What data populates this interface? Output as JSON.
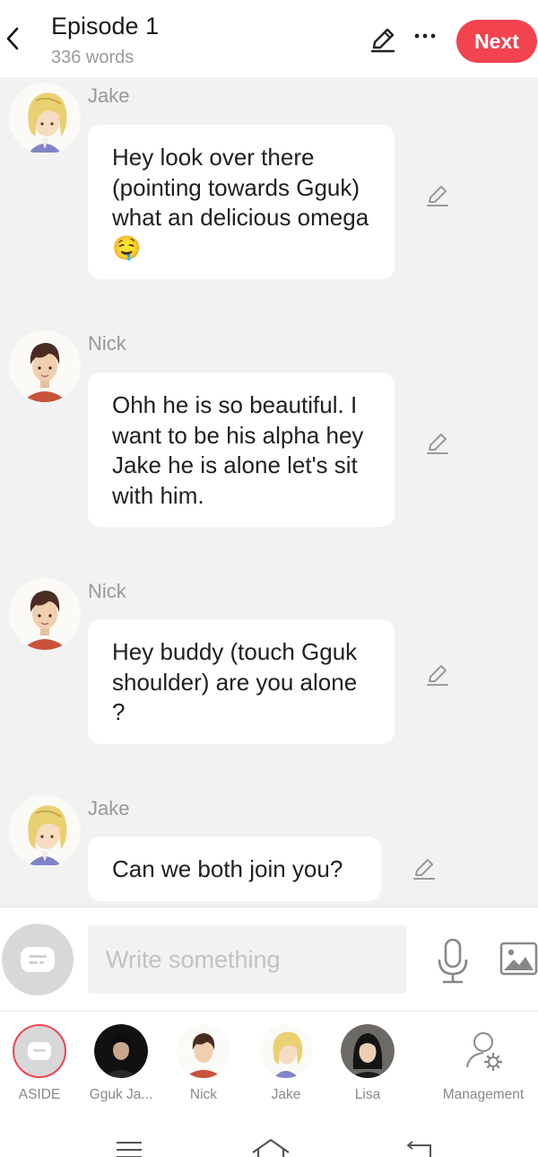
{
  "header": {
    "title": "Episode 1",
    "word_count": "336 words",
    "next_label": "Next"
  },
  "messages": [
    {
      "speaker": "Jake",
      "text": "Hey look over there (pointing towards Gguk) what an delicious omega 🤤"
    },
    {
      "speaker": "Nick",
      "text": "Ohh he is so beautiful. I want to be his alpha hey Jake he is alone let's sit with him."
    },
    {
      "speaker": "Nick",
      "text": "Hey buddy (touch Gguk shoulder) are you alone ?"
    },
    {
      "speaker": "Jake",
      "text": "Can we both join you?"
    }
  ],
  "composer": {
    "placeholder": "Write something"
  },
  "characters": [
    {
      "label": "ASIDE"
    },
    {
      "label": "Gguk Ja..."
    },
    {
      "label": "Nick"
    },
    {
      "label": "Jake"
    },
    {
      "label": "Lisa"
    },
    {
      "label": "Management"
    }
  ],
  "colors": {
    "accent": "#f2434f",
    "background": "#f2f2f2",
    "bubble": "#ffffff"
  }
}
